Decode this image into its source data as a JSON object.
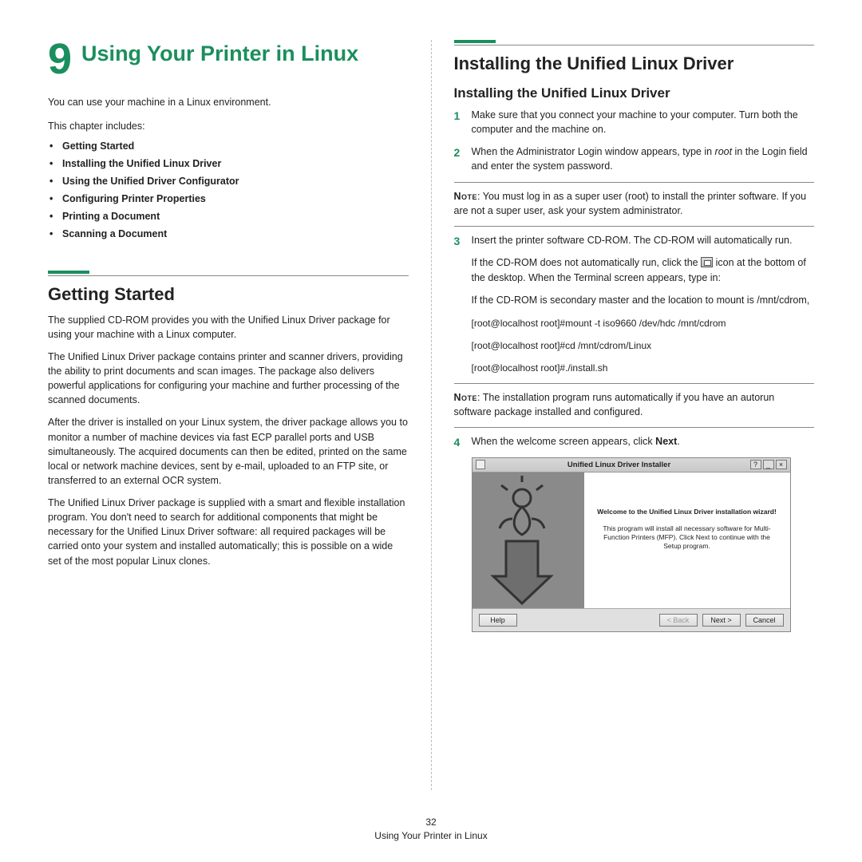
{
  "chapter": {
    "number": "9",
    "title": "Using Your Printer in Linux"
  },
  "left": {
    "intro": "You can use your machine in a Linux environment.",
    "includes_label": "This chapter includes:",
    "bullets": [
      "Getting Started",
      "Installing the Unified Linux Driver",
      "Using the Unified Driver Configurator",
      "Configuring Printer Properties",
      "Printing a Document",
      "Scanning a Document"
    ],
    "section_title": "Getting Started",
    "p1": "The supplied CD-ROM provides you with the Unified Linux Driver package for using your machine with a Linux computer.",
    "p2": "The Unified Linux Driver package contains printer and scanner drivers, providing the ability to print documents and scan images. The package also delivers powerful applications for configuring your machine and further processing of the scanned documents.",
    "p3": "After the driver is installed on your Linux system, the driver package allows you to monitor a number of machine devices via fast ECP parallel ports and USB simultaneously. The acquired documents can then be edited, printed on the same local or network machine devices, sent by e-mail, uploaded to an FTP site, or transferred to an external OCR system.",
    "p4": "The Unified Linux Driver package is supplied with a smart and flexible installation program. You don't need to search for additional components that might be necessary for the Unified Linux Driver software: all required packages will be carried onto your system and installed automatically; this is possible on a wide set of the most popular Linux clones."
  },
  "right": {
    "h2": "Installing the Unified Linux Driver",
    "h3": "Installing the Unified Linux Driver",
    "step1": "Make sure that you connect your machine to your computer. Turn both the computer and the machine on.",
    "step2_a": "When the Administrator Login window appears, type in ",
    "step2_root": "root",
    "step2_b": " in the Login field and enter the system password.",
    "note1_label": "Note",
    "note1": ": You must log in as a super user (root) to install the printer software. If you are not a super user, ask your system administrator.",
    "step3": "Insert the printer software CD-ROM. The CD-ROM will automatically run.",
    "sub_a1": "If the CD-ROM does not automatically run, click the ",
    "sub_a2": " icon at the bottom of the desktop. When the Terminal screen appears, type in:",
    "sub_b": "If the CD-ROM is secondary master and the location to mount is /mnt/cdrom,",
    "cmd1": "[root@localhost root]#mount -t iso9660 /dev/hdc /mnt/cdrom",
    "cmd2": "[root@localhost root]#cd /mnt/cdrom/Linux",
    "cmd3": "[root@localhost root]#./install.sh",
    "note2_label": "Note",
    "note2": ": The installation program runs automatically if you have an autorun software package installed and configured.",
    "step4_a": "When the welcome screen appears, click ",
    "step4_b": "Next",
    "step4_c": ".",
    "installer": {
      "title": "Unified Linux Driver Installer",
      "heading": "Welcome to the Unified Linux Driver installation wizard!",
      "body": "This program will install all necessary software for Multi-Function Printers (MFP). Click Next to continue with the Setup program.",
      "help": "Help",
      "back": "< Back",
      "next": "Next >",
      "cancel": "Cancel"
    }
  },
  "footer": {
    "page": "32",
    "title": "Using Your Printer in Linux"
  }
}
